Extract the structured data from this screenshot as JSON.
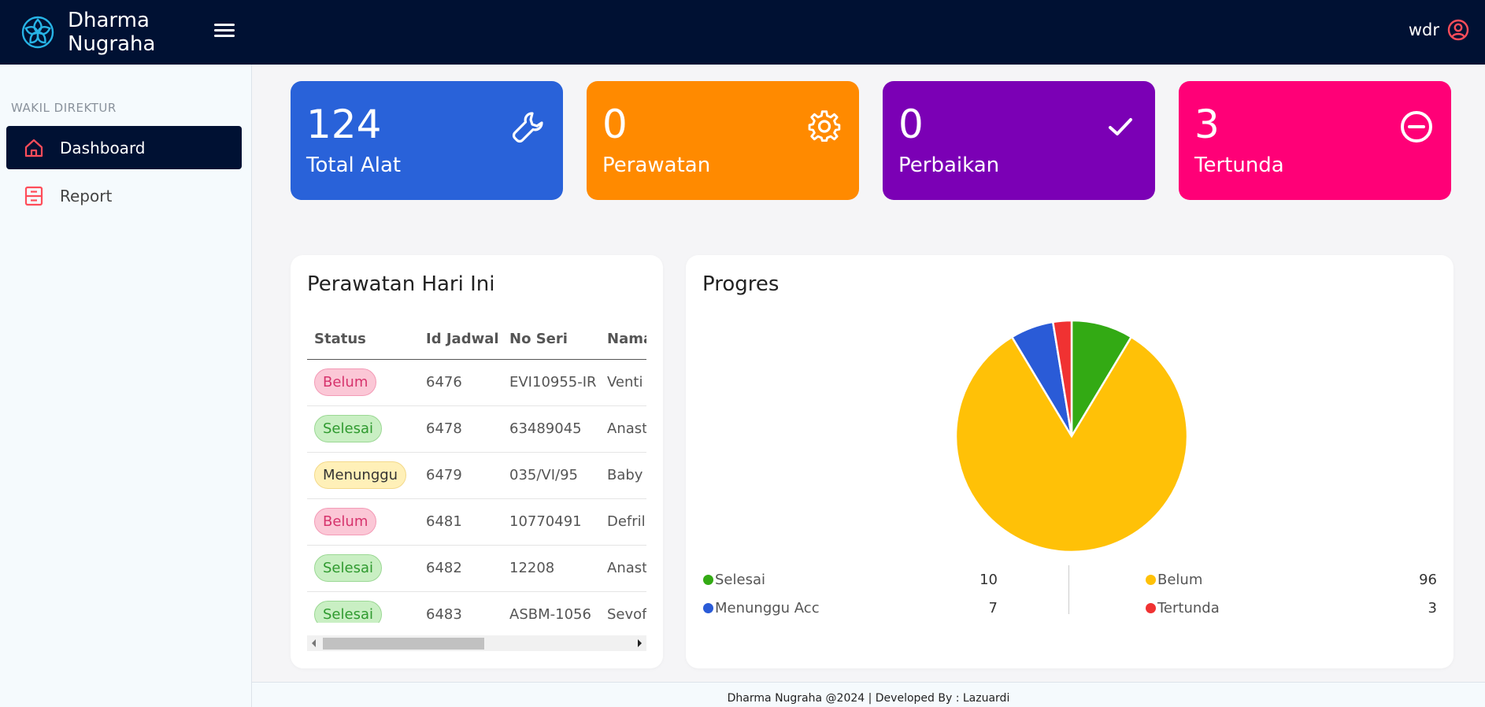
{
  "header": {
    "brand_line1": "Dharma",
    "brand_line2": "Nugraha",
    "username": "wdr"
  },
  "sidebar": {
    "section": "WAKIL DIREKTUR",
    "items": [
      {
        "label": "Dashboard",
        "icon": "home-icon",
        "active": true
      },
      {
        "label": "Report",
        "icon": "report-icon",
        "active": false
      }
    ]
  },
  "cards": [
    {
      "value": "124",
      "label": "Total Alat",
      "color": "#2962d9",
      "icon": "wrench-icon"
    },
    {
      "value": "0",
      "label": "Perawatan",
      "color": "#ff8a00",
      "icon": "gear-icon"
    },
    {
      "value": "0",
      "label": "Perbaikan",
      "color": "#7b00b5",
      "icon": "check-icon"
    },
    {
      "value": "3",
      "label": "Tertunda",
      "color": "#ff0077",
      "icon": "minus-circle-icon"
    }
  ],
  "maintenance": {
    "title": "Perawatan Hari Ini",
    "columns": [
      "Status",
      "Id Jadwal",
      "No Seri",
      "Nama"
    ],
    "rows": [
      {
        "status": "Belum",
        "id": "6476",
        "serial": "EVI10955-IR",
        "name": "Venti"
      },
      {
        "status": "Selesai",
        "id": "6478",
        "serial": "63489045",
        "name": "Anast"
      },
      {
        "status": "Menunggu",
        "id": "6479",
        "serial": "035/VI/95",
        "name": "Baby"
      },
      {
        "status": "Belum",
        "id": "6481",
        "serial": "10770491",
        "name": "Defril"
      },
      {
        "status": "Selesai",
        "id": "6482",
        "serial": "12208",
        "name": "Anast"
      },
      {
        "status": "Selesai",
        "id": "6483",
        "serial": "ASBM-1056",
        "name": "Sevof"
      }
    ]
  },
  "progress": {
    "title": "Progres"
  },
  "chart_data": {
    "type": "pie",
    "categories": [
      "Selesai",
      "Belum",
      "Menunggu Acc",
      "Tertunda"
    ],
    "values": [
      10,
      96,
      7,
      3
    ],
    "colors": [
      "#33aa14",
      "#ffc107",
      "#2a5bd7",
      "#f03232"
    ],
    "legend_position": "bottom"
  },
  "footer": {
    "text": "Dharma Nugraha @2024 | Developed By : Lazuardi"
  }
}
